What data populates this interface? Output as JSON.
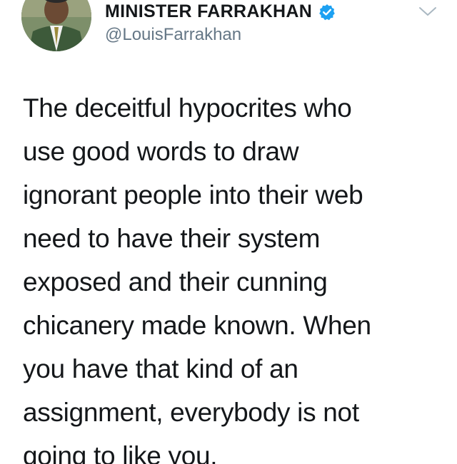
{
  "tweet": {
    "author_name": "MINISTER FARRAKHAN",
    "author_handle": "@LouisFarrakhan",
    "verified_icon": "verified-badge-icon",
    "caret_icon": "chevron-down-icon",
    "accent_color": "#1da1f2",
    "text_lines": [
      "The deceitful hypocrites who",
      "use good words to draw",
      "ignorant people into their web",
      "need to have their system",
      "exposed and their cunning",
      "chicanery made known. When",
      "you have that kind of an",
      "assignment, everybody is not",
      "going to like you."
    ]
  }
}
